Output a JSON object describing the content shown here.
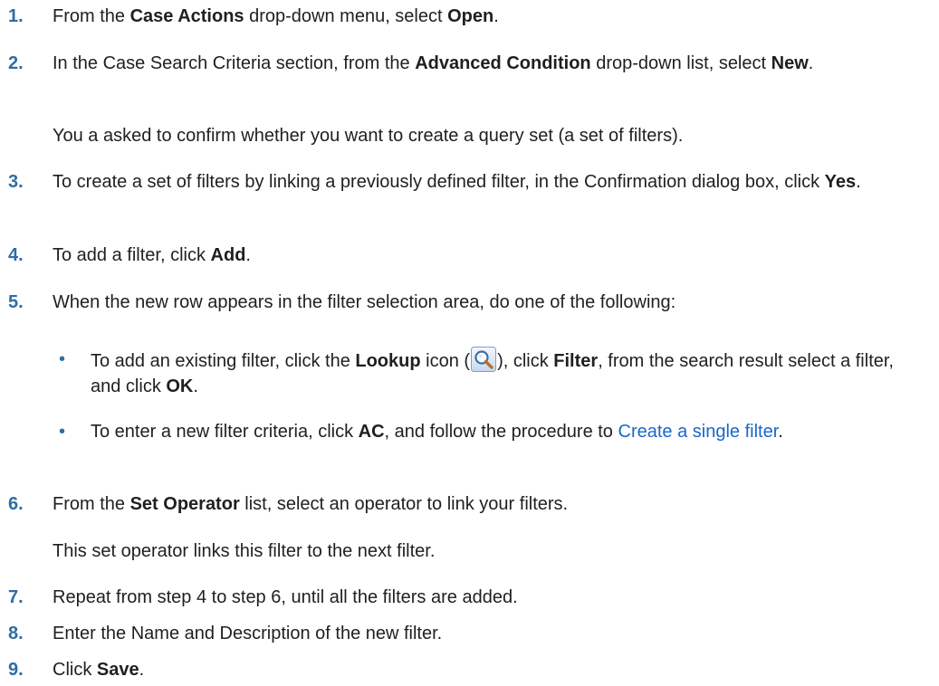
{
  "steps": [
    {
      "num": "1.",
      "pre": "From the ",
      "b1": "Case Actions",
      "mid": " drop-down menu, select ",
      "b2": "Open",
      "post": "."
    },
    {
      "num": "2.",
      "pre": "In the Case Search Criteria section, from the ",
      "b1": "Advanced Condition",
      "mid": " drop-down list, select ",
      "b2": "New",
      "post": "."
    },
    {
      "note": "You a asked to confirm whether you want to create a query set (a set of filters)."
    },
    {
      "num": "3.",
      "pre": "To create a set of filters by linking a previously defined filter, in the Confirmation dialog box, click ",
      "b1": "Yes",
      "post": "."
    },
    {
      "num": "4.",
      "pre": "To add a filter, click ",
      "b1": "Add",
      "post": "."
    },
    {
      "num": "5.",
      "text": "When the new row appears in the filter selection area, do one of the following:"
    },
    {
      "num": "6.",
      "pre": "From the ",
      "b1": "Set Operator",
      "post": " list, select an operator to link your filters."
    },
    {
      "note": "This set operator links this filter to the next filter."
    },
    {
      "num": "7.",
      "text": "Repeat from step 4 to step 6, until all the filters are added."
    },
    {
      "num": "8.",
      "text": "Enter the Name and Description of the new filter."
    },
    {
      "num": "9.",
      "pre": "Click ",
      "b1": "Save",
      "post": "."
    }
  ],
  "substeps": [
    {
      "bullet": "•",
      "pre": "To add an existing filter, click the ",
      "b1": "Lookup",
      "mid1": " icon (",
      "mid2": "), click ",
      "b2": "Filter",
      "mid3": ", from the search result select a filter, and click ",
      "b3": "OK",
      "post": "."
    },
    {
      "bullet": "•",
      "pre": "To enter a new filter criteria, click ",
      "b1": "AC",
      "mid": ", and follow the procedure to ",
      "link": "Create a single filter",
      "post": "."
    }
  ],
  "icons": {
    "lookup": "magnifier-lookup-icon"
  },
  "colors": {
    "number": "#2e6ca8",
    "link": "#1a66cc",
    "text": "#1f1f1f"
  }
}
